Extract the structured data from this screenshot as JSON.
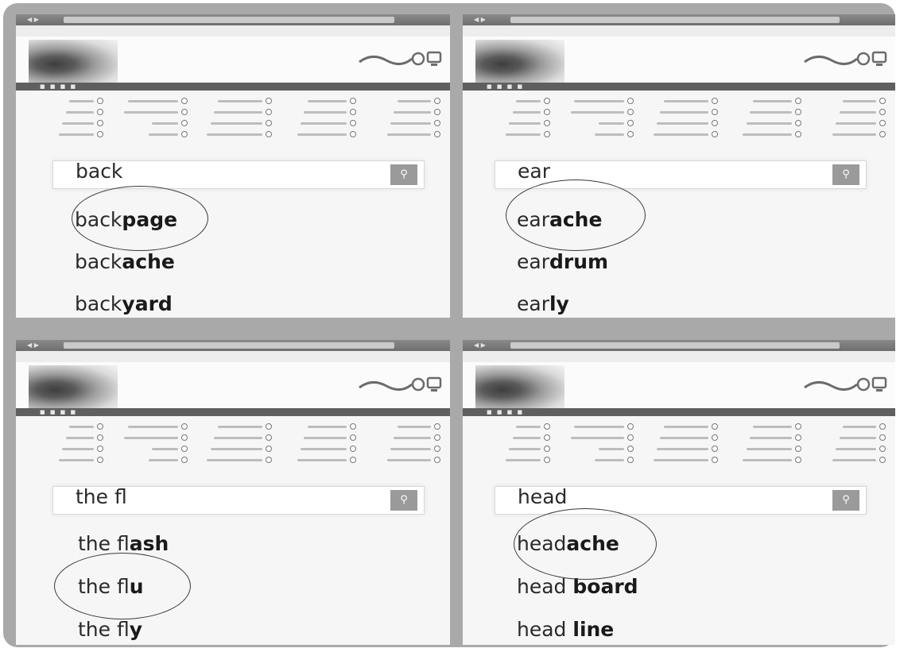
{
  "panels": [
    {
      "id": "back",
      "query": "back",
      "suggestions": [
        {
          "prefix": "back",
          "suffix": "page",
          "circled": true
        },
        {
          "prefix": "back",
          "suffix": "ache",
          "circled": false
        },
        {
          "prefix": "back",
          "suffix": "yard",
          "circled": false
        }
      ]
    },
    {
      "id": "ear",
      "query": "ear",
      "suggestions": [
        {
          "prefix": "ear",
          "suffix": "ache",
          "circled": true
        },
        {
          "prefix": "ear",
          "suffix": "drum",
          "circled": false
        },
        {
          "prefix": "ear",
          "suffix": "ly",
          "circled": false
        }
      ]
    },
    {
      "id": "the-fl",
      "query": "the fl",
      "suggestions": [
        {
          "prefix": "the fl",
          "suffix": "ash",
          "circled": false
        },
        {
          "prefix": "the fl",
          "suffix": "u",
          "circled": true
        },
        {
          "prefix": "the fl",
          "suffix": "y",
          "circled": false
        }
      ]
    },
    {
      "id": "head",
      "query": "head",
      "suggestions": [
        {
          "prefix": "head",
          "suffix": "ache",
          "circled": true
        },
        {
          "prefix": "head ",
          "suffix": "board",
          "circled": false
        },
        {
          "prefix": "head ",
          "suffix": "line",
          "circled": false
        }
      ]
    }
  ],
  "icons": {
    "search_button": "search-icon",
    "logo": "site-logo-icon",
    "avatar": "avatar"
  },
  "colors": {
    "frame": "#a9a9a9",
    "navbar": "#5f5f5f",
    "circle": "#3a3a3a"
  }
}
